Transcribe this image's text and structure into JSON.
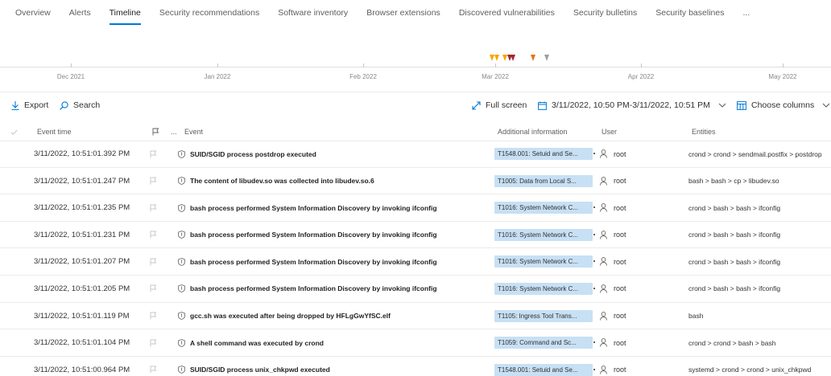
{
  "tabs": [
    {
      "label": "Overview",
      "active": false
    },
    {
      "label": "Alerts",
      "active": false
    },
    {
      "label": "Timeline",
      "active": true
    },
    {
      "label": "Security recommendations",
      "active": false
    },
    {
      "label": "Software inventory",
      "active": false
    },
    {
      "label": "Browser extensions",
      "active": false
    },
    {
      "label": "Discovered vulnerabilities",
      "active": false
    },
    {
      "label": "Security bulletins",
      "active": false
    },
    {
      "label": "Security baselines",
      "active": false
    },
    {
      "label": "...",
      "active": false
    }
  ],
  "timeline": {
    "months": [
      "Dec 2021",
      "Jan 2022",
      "Feb 2022",
      "Mar 2022",
      "Apr 2022",
      "May 2022"
    ],
    "marker_colors": {
      "yellow": "#f7a700",
      "dark": "#a4262c",
      "orange": "#e8730c",
      "gray": "#a19f9d"
    }
  },
  "toolbar": {
    "export_label": "Export",
    "search_label": "Search",
    "fullscreen_label": "Full screen",
    "date_range": "3/11/2022, 10:50 PM-3/11/2022, 10:51 PM",
    "choose_columns_label": "Choose columns"
  },
  "table": {
    "headers": {
      "event_time": "Event time",
      "more": "...",
      "event": "Event",
      "additional_info": "Additional information",
      "user": "User",
      "entities": "Entities"
    },
    "rows": [
      {
        "time": "3/11/2022, 10:51:01.392 PM",
        "event": "SUID/SGID process postdrop executed",
        "info": "T1548.001: Setuid and Se...",
        "user": "root",
        "entities": "crond > crond > sendmail.postfix > postdrop"
      },
      {
        "time": "3/11/2022, 10:51:01.247 PM",
        "event": "The content of libudev.so was collected into libudev.so.6",
        "info": "T1005: Data from Local S...",
        "user": "root",
        "entities": "bash > bash > cp > libudev.so"
      },
      {
        "time": "3/11/2022, 10:51:01.235 PM",
        "event": "bash process performed System Information Discovery by invoking ifconfig",
        "info": "T1016: System Network C...",
        "user": "root",
        "entities": "crond > bash > bash > ifconfig"
      },
      {
        "time": "3/11/2022, 10:51:01.231 PM",
        "event": "bash process performed System Information Discovery by invoking ifconfig",
        "info": "T1016: System Network C...",
        "user": "root",
        "entities": "crond > bash > bash > ifconfig"
      },
      {
        "time": "3/11/2022, 10:51:01.207 PM",
        "event": "bash process performed System Information Discovery by invoking ifconfig",
        "info": "T1016: System Network C...",
        "user": "root",
        "entities": "crond > bash > bash > ifconfig"
      },
      {
        "time": "3/11/2022, 10:51:01.205 PM",
        "event": "bash process performed System Information Discovery by invoking ifconfig",
        "info": "T1016: System Network C...",
        "user": "root",
        "entities": "crond > bash > bash > ifconfig"
      },
      {
        "time": "3/11/2022, 10:51:01.119 PM",
        "event": "gcc.sh was executed after being dropped by HFLgGwYfSC.elf",
        "info": "T1105: Ingress Tool Trans...",
        "user": "root",
        "entities": "bash"
      },
      {
        "time": "3/11/2022, 10:51:01.104 PM",
        "event": "A shell command was executed by crond",
        "info": "T1059: Command and Sc...",
        "user": "root",
        "entities": "crond > crond > bash > bash"
      },
      {
        "time": "3/11/2022, 10:51:00.964 PM",
        "event": "SUID/SGID process unix_chkpwd executed",
        "info": "T1548.001: Setuid and Se...",
        "user": "root",
        "entities": "systemd > crond > crond > unix_chkpwd"
      }
    ]
  },
  "colors": {
    "accent": "#0078d4",
    "tag_bg": "#c7e0f4"
  }
}
